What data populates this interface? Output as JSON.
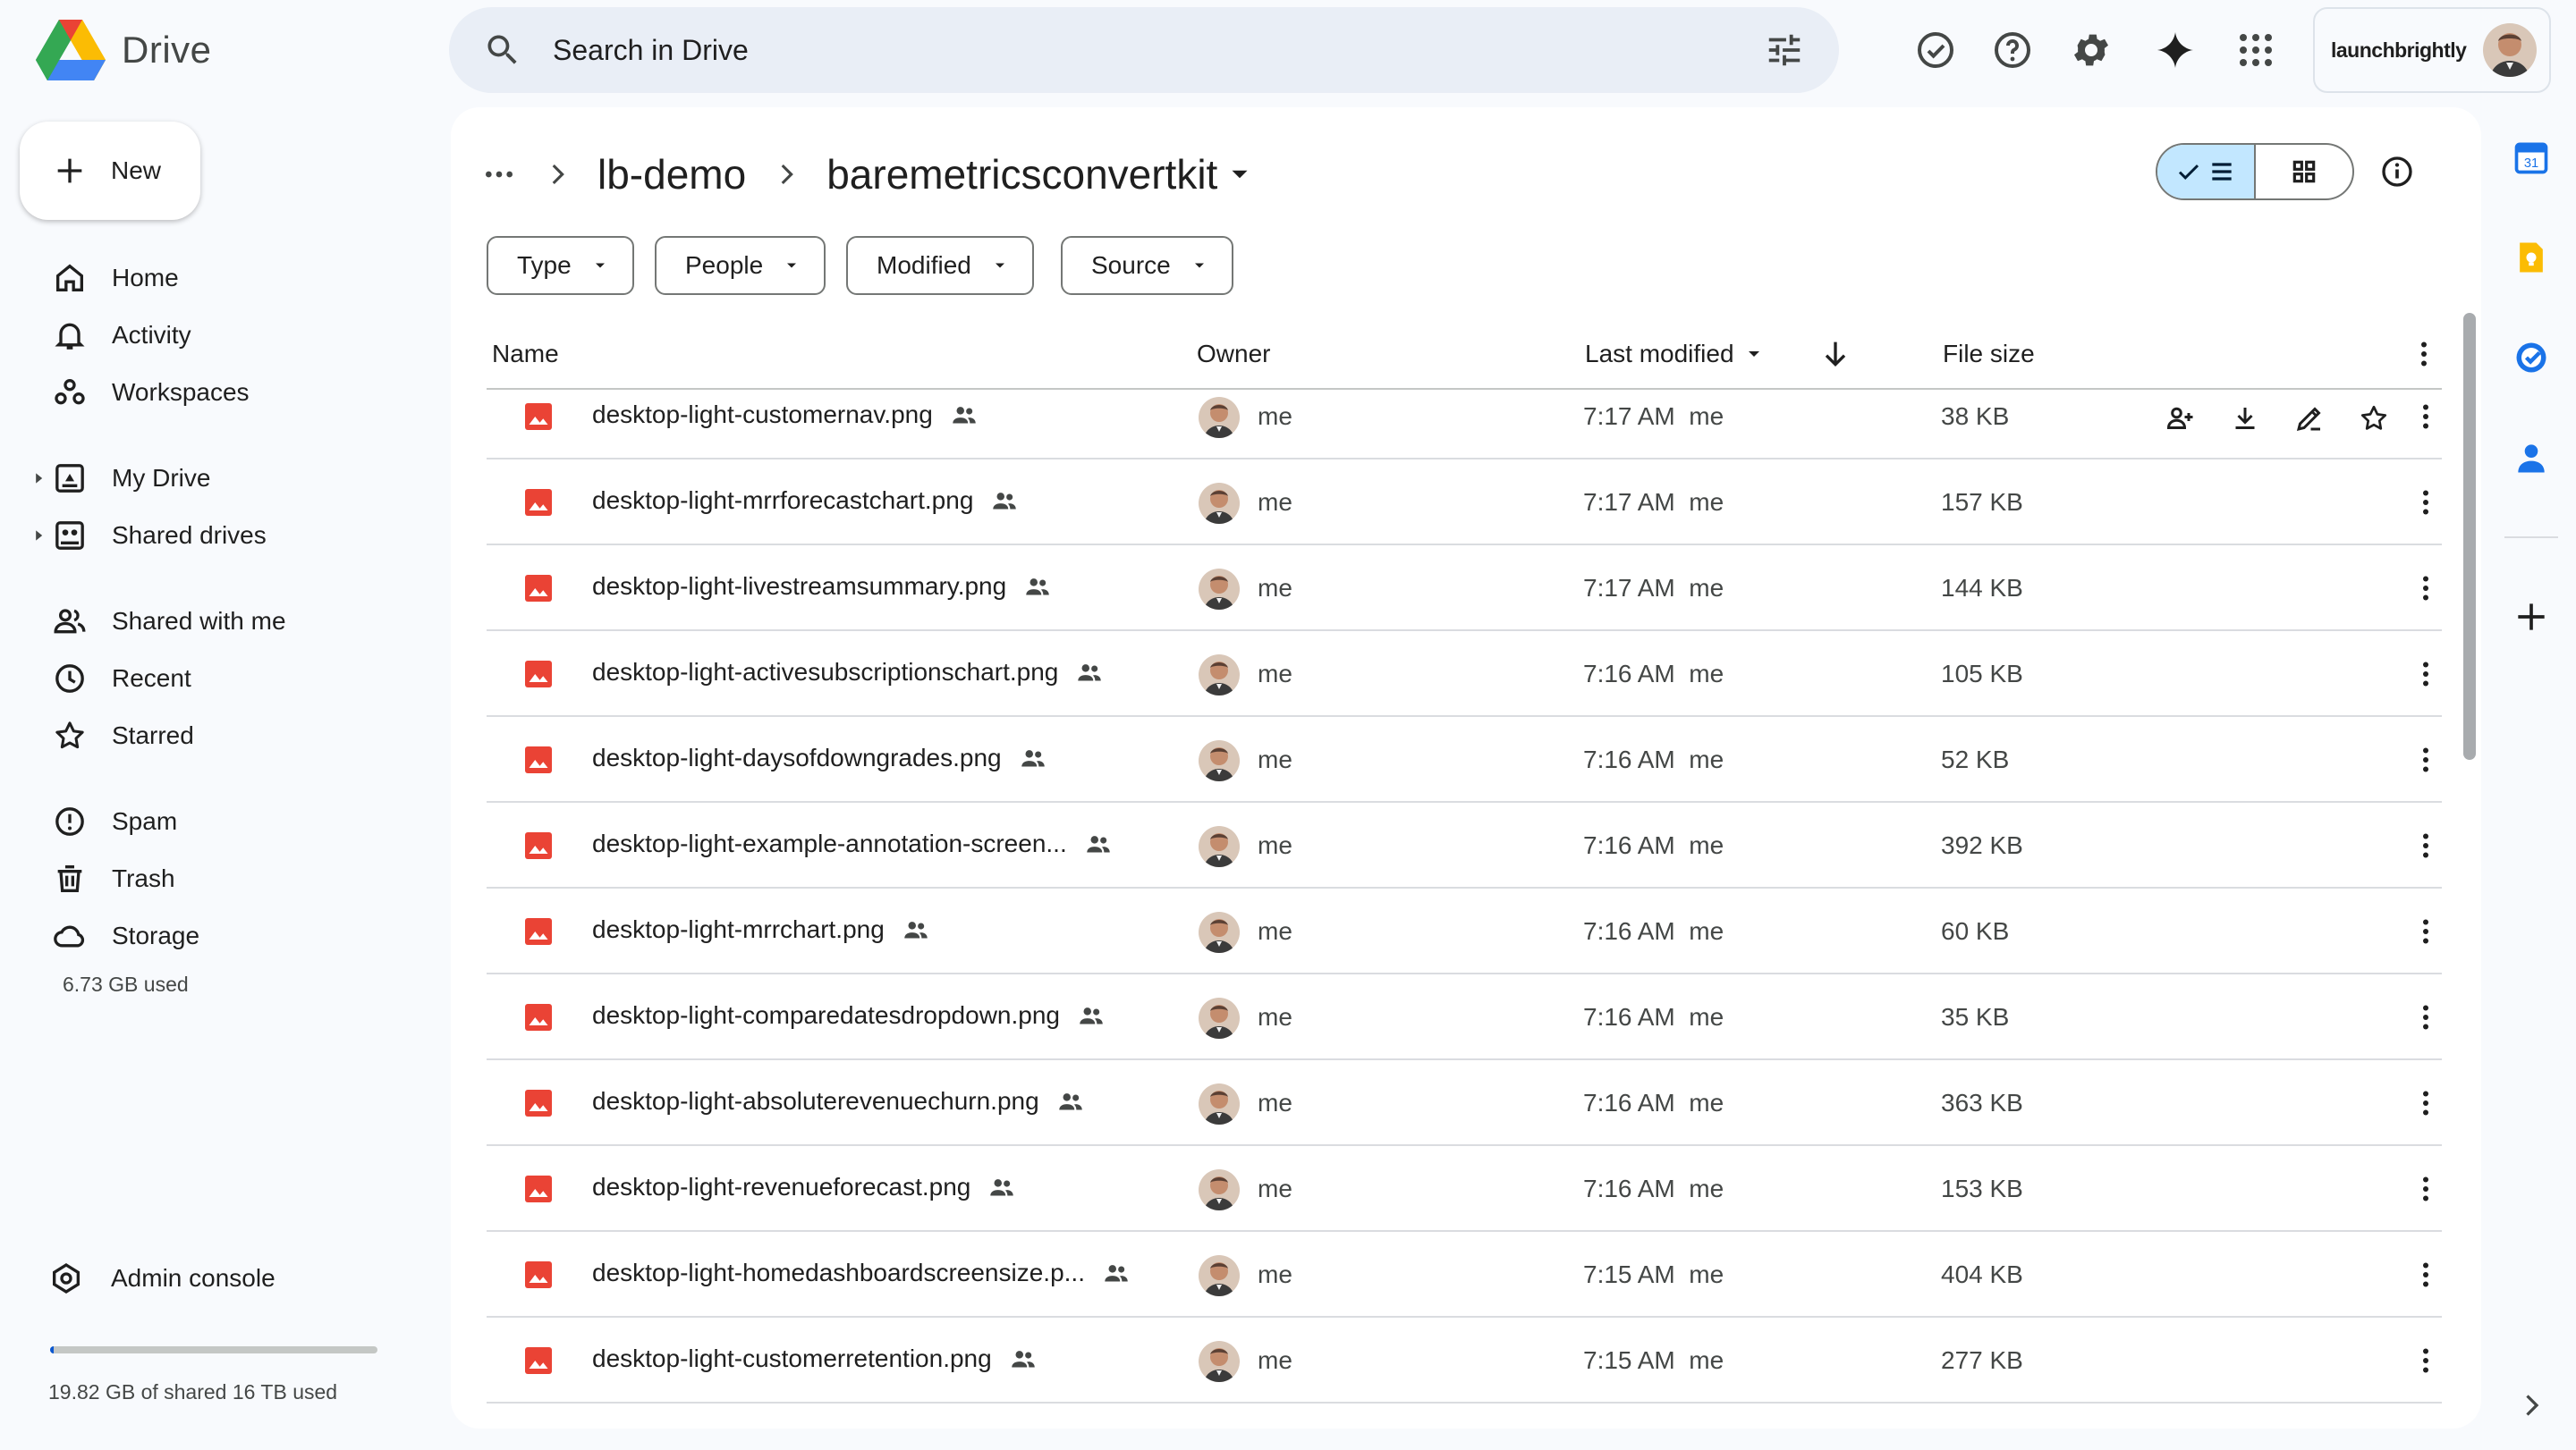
{
  "app": {
    "name": "Drive"
  },
  "search": {
    "placeholder": "Search in Drive"
  },
  "header": {
    "org_name": "launchbrightly"
  },
  "sidebar": {
    "new_label": "New",
    "items": [
      {
        "label": "Home",
        "icon": "home-icon"
      },
      {
        "label": "Activity",
        "icon": "bell-icon"
      },
      {
        "label": "Workspaces",
        "icon": "workspaces-icon"
      },
      {
        "label": "My Drive",
        "icon": "my-drive-icon"
      },
      {
        "label": "Shared drives",
        "icon": "shared-drives-icon"
      },
      {
        "label": "Shared with me",
        "icon": "people-icon"
      },
      {
        "label": "Recent",
        "icon": "clock-icon"
      },
      {
        "label": "Starred",
        "icon": "star-icon"
      },
      {
        "label": "Spam",
        "icon": "spam-icon"
      },
      {
        "label": "Trash",
        "icon": "trash-icon"
      },
      {
        "label": "Storage",
        "icon": "cloud-icon"
      }
    ],
    "storage_used": "6.73 GB used",
    "admin_label": "Admin console",
    "quota_text": "19.82 GB of shared 16 TB used",
    "quota_fraction": 0.0012
  },
  "breadcrumb": {
    "parent": "lb-demo",
    "current": "baremetricsconvertkit"
  },
  "filters": [
    "Type",
    "People",
    "Modified",
    "Source"
  ],
  "table": {
    "headers": {
      "name": "Name",
      "owner": "Owner",
      "modified": "Last modified",
      "size": "File size"
    },
    "rows": [
      {
        "name": "desktop-light-customernav.png",
        "owner": "me",
        "modified": "7:17 AM  me",
        "size": "38 KB"
      },
      {
        "name": "desktop-light-mrrforecastchart.png",
        "owner": "me",
        "modified": "7:17 AM  me",
        "size": "157 KB"
      },
      {
        "name": "desktop-light-livestreamsummary.png",
        "owner": "me",
        "modified": "7:17 AM  me",
        "size": "144 KB"
      },
      {
        "name": "desktop-light-activesubscriptionschart.png",
        "owner": "me",
        "modified": "7:16 AM  me",
        "size": "105 KB"
      },
      {
        "name": "desktop-light-daysofdowngrades.png",
        "owner": "me",
        "modified": "7:16 AM  me",
        "size": "52 KB"
      },
      {
        "name": "desktop-light-example-annotation-screen...",
        "owner": "me",
        "modified": "7:16 AM  me",
        "size": "392 KB"
      },
      {
        "name": "desktop-light-mrrchart.png",
        "owner": "me",
        "modified": "7:16 AM  me",
        "size": "60 KB"
      },
      {
        "name": "desktop-light-comparedatesdropdown.png",
        "owner": "me",
        "modified": "7:16 AM  me",
        "size": "35 KB"
      },
      {
        "name": "desktop-light-absoluterevenuechurn.png",
        "owner": "me",
        "modified": "7:16 AM  me",
        "size": "363 KB"
      },
      {
        "name": "desktop-light-revenueforecast.png",
        "owner": "me",
        "modified": "7:16 AM  me",
        "size": "153 KB"
      },
      {
        "name": "desktop-light-homedashboardscreensize.p...",
        "owner": "me",
        "modified": "7:15 AM  me",
        "size": "404 KB"
      },
      {
        "name": "desktop-light-customerretention.png",
        "owner": "me",
        "modified": "7:15 AM  me",
        "size": "277 KB"
      }
    ]
  },
  "colors": {
    "accent": "#0b57d0",
    "selected": "#c2e7ff",
    "image_file": "#ea4335"
  }
}
